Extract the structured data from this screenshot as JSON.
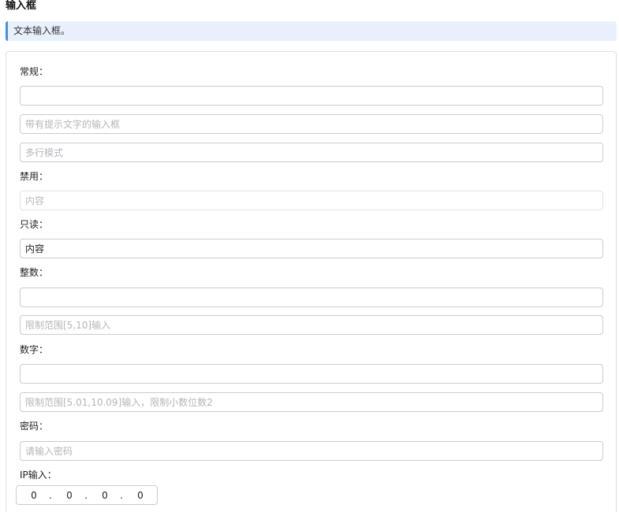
{
  "page_title": "输入框",
  "banner_text": "文本输入框。",
  "sections": {
    "normal": {
      "label": "常规：",
      "plain_value": "",
      "hint_placeholder": "带有提示文字的输入框",
      "multiline_placeholder": "多行模式"
    },
    "disabled": {
      "label": "禁用：",
      "placeholder": "内容"
    },
    "readonly": {
      "label": "只读：",
      "value": "内容"
    },
    "integer": {
      "label": "整数：",
      "plain_value": "",
      "range_placeholder": "限制范围[5,10]输入"
    },
    "number": {
      "label": "数字：",
      "plain_value": "",
      "range_placeholder": "限制范围[5.01,10.09]输入，限制小数位数2"
    },
    "password": {
      "label": "密码：",
      "placeholder": "请输入密码"
    },
    "ip": {
      "label": "IP输入：",
      "segments": [
        "0",
        "0",
        "0",
        "0"
      ],
      "separator": "."
    }
  }
}
